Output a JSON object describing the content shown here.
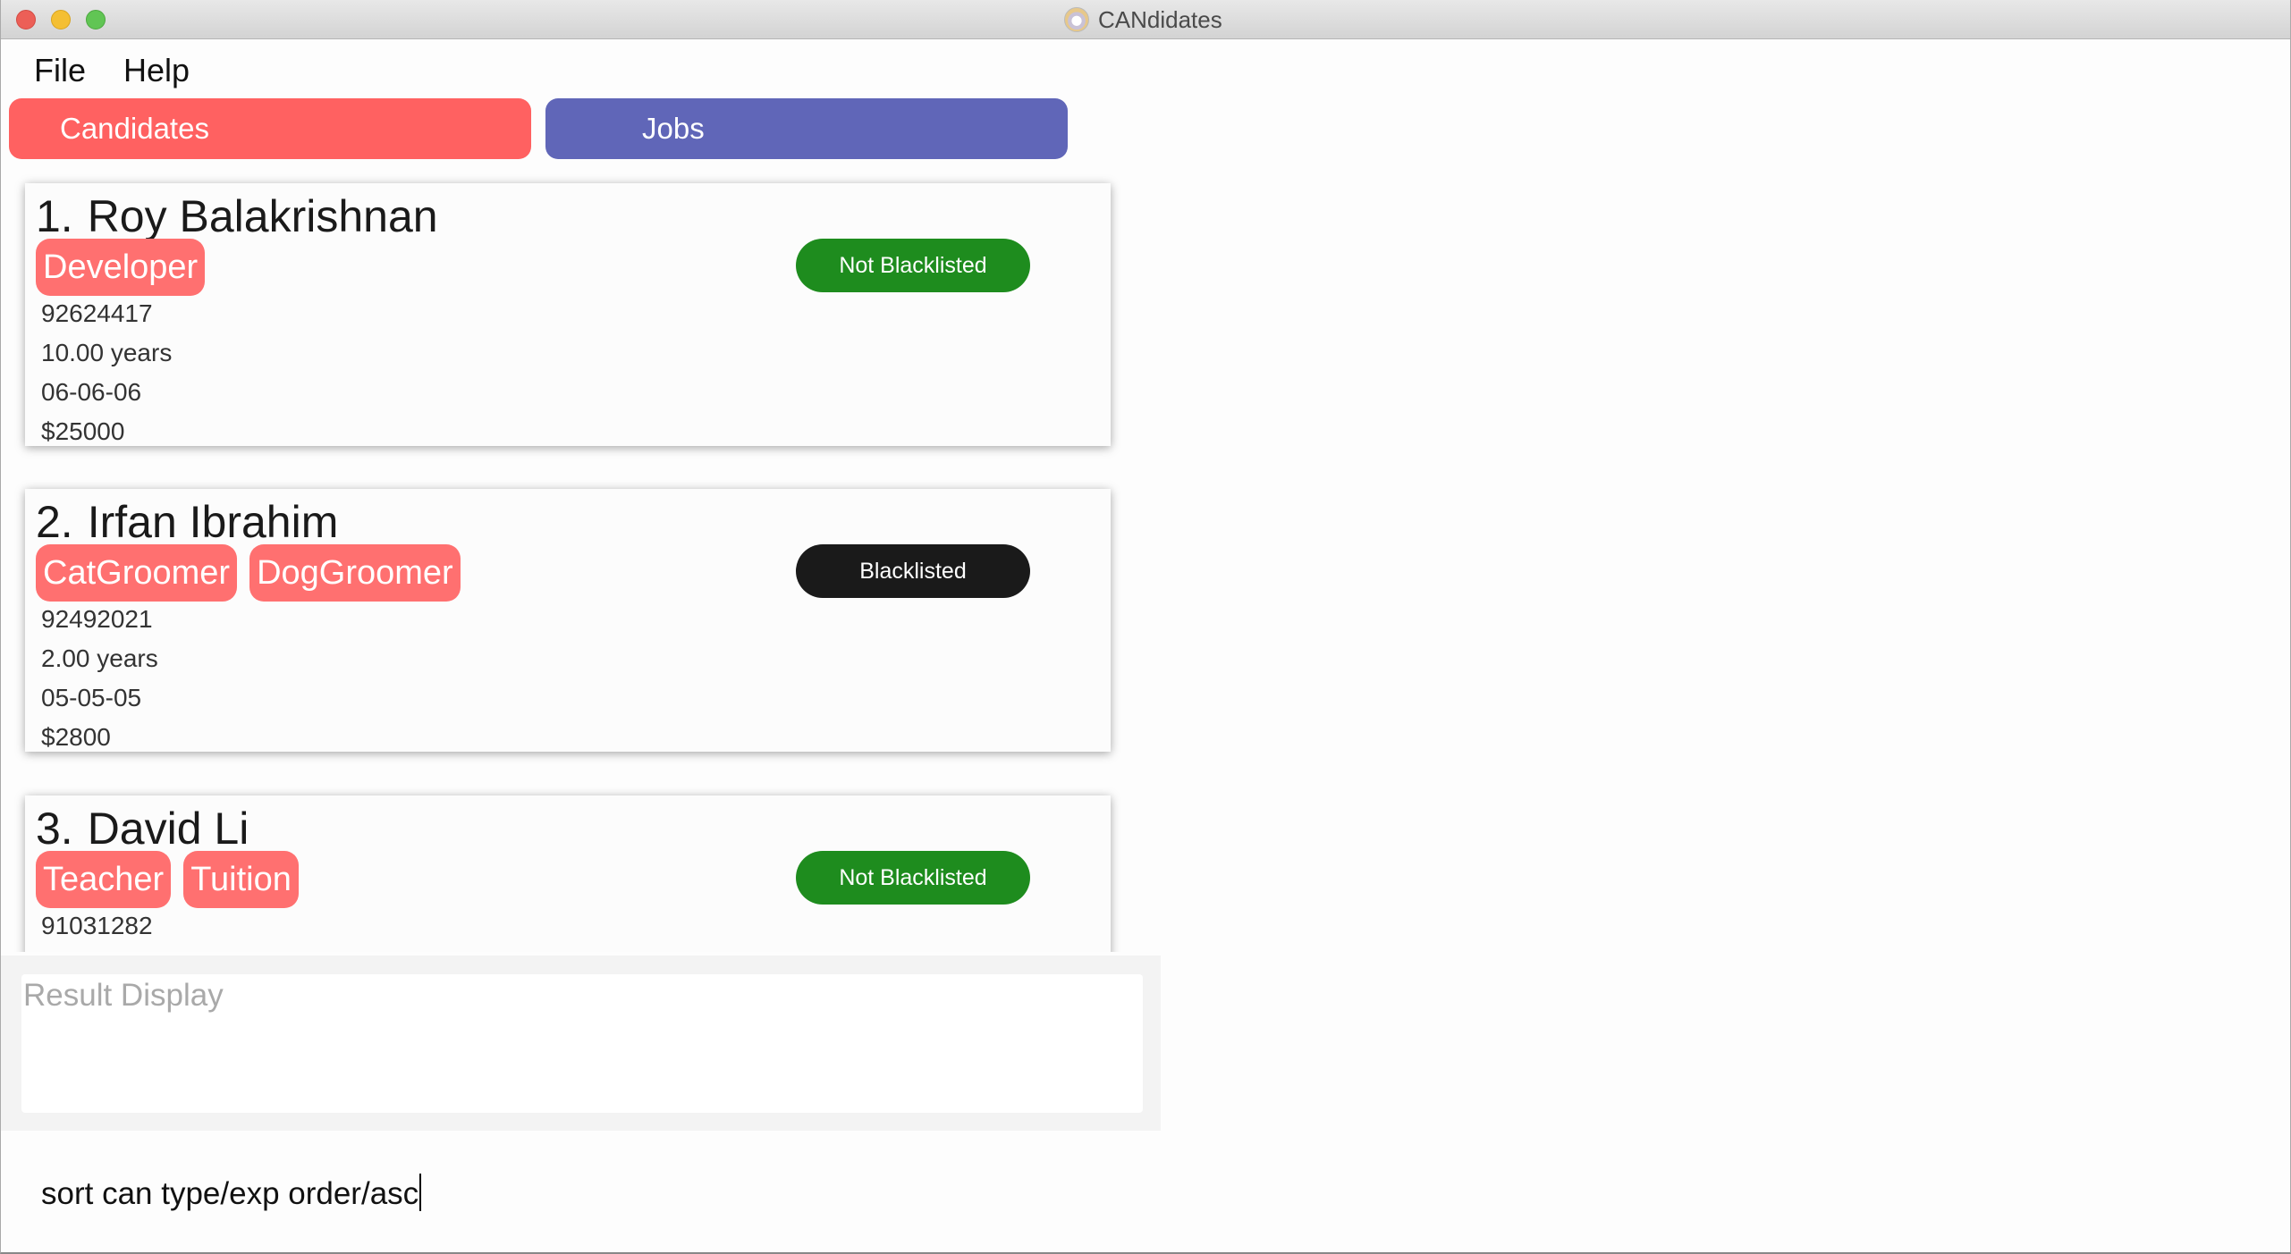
{
  "window": {
    "title": "CANdidates",
    "app_icon": "candidates-app-icon",
    "controls": [
      "close",
      "minimize",
      "maximize"
    ]
  },
  "menu": {
    "items": [
      {
        "label": "File"
      },
      {
        "label": "Help"
      }
    ]
  },
  "tabs": [
    {
      "label": "Candidates",
      "color": "#ff6161",
      "active": true
    },
    {
      "label": "Jobs",
      "color": "#6066b8",
      "active": false
    }
  ],
  "candidates": [
    {
      "index": "1.",
      "name": "Roy Balakrishnan",
      "tags": [
        "Developer"
      ],
      "status": "Not Blacklisted",
      "status_color": "#1e8c1e",
      "phone": "92624417",
      "experience": "10.00 years",
      "date": "06-06-06",
      "salary": "$25000"
    },
    {
      "index": "2.",
      "name": "Irfan Ibrahim",
      "tags": [
        "CatGroomer",
        "DogGroomer"
      ],
      "status": "Blacklisted",
      "status_color": "#1a1a1a",
      "phone": "92492021",
      "experience": "2.00 years",
      "date": "05-05-05",
      "salary": "$2800"
    },
    {
      "index": "3.",
      "name": "David Li",
      "tags": [
        "Teacher",
        "Tuition"
      ],
      "status": "Not Blacklisted",
      "status_color": "#1e8c1e",
      "phone": "91031282"
    }
  ],
  "result_display": {
    "placeholder": "Result Display",
    "value": ""
  },
  "command_box": {
    "value": "sort can type/exp order/asc"
  },
  "colors": {
    "tag_bg": "#ff7070",
    "not_blacklisted": "#1e8c1e",
    "blacklisted": "#1a1a1a"
  }
}
